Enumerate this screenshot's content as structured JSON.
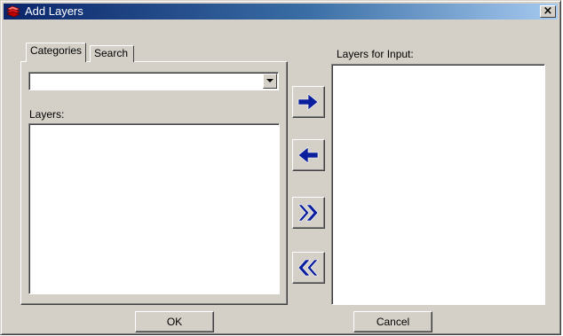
{
  "window": {
    "title": "Add Layers",
    "close_glyph": "×"
  },
  "tabs": [
    {
      "label": "Categories",
      "active": true
    },
    {
      "label": "Search",
      "active": false
    }
  ],
  "category_select": {
    "value": ""
  },
  "layers_panel": {
    "label": "Layers:",
    "items": []
  },
  "input_panel": {
    "label": "Layers for Input:",
    "items": []
  },
  "transfer_buttons": {
    "add": "arrow-right-icon",
    "remove": "arrow-left-icon",
    "add_all": "double-arrow-right-icon",
    "remove_all": "double-arrow-left-icon"
  },
  "buttons": {
    "ok": "OK",
    "cancel": "Cancel"
  },
  "colors": {
    "arrow_fill": "#0b1f9c",
    "title_start": "#0a246a",
    "title_end": "#a6caf0",
    "face": "#d4d0c8"
  }
}
